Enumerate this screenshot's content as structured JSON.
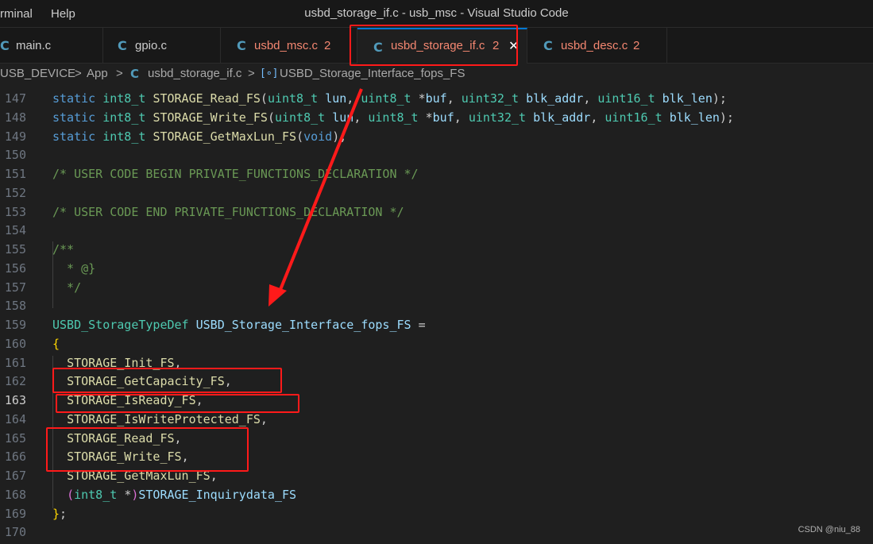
{
  "window": {
    "title": "usbd_storage_if.c - usb_msc - Visual Studio Code",
    "menu": [
      "rminal",
      "Help"
    ]
  },
  "tabs": [
    {
      "label": "main.c",
      "badge": "",
      "error": false,
      "active": false
    },
    {
      "label": "gpio.c",
      "badge": "",
      "error": false,
      "active": false
    },
    {
      "label": "usbd_msc.c",
      "badge": "2",
      "error": true,
      "active": false
    },
    {
      "label": "usbd_storage_if.c",
      "badge": "2",
      "error": true,
      "active": true
    },
    {
      "label": "usbd_desc.c",
      "badge": "2",
      "error": true,
      "active": false
    }
  ],
  "tab_icon": "C",
  "close_glyph": "✕",
  "breadcrumb": {
    "segments": [
      "USB_DEVICE",
      "App",
      "usbd_storage_if.c",
      "USBD_Storage_Interface_fops_FS"
    ],
    "separator": ">",
    "symbol_glyph": "[∘]"
  },
  "editor": {
    "current_line": "163",
    "lines": [
      {
        "num": "147",
        "tokens": [
          [
            "kw",
            "static "
          ],
          [
            "ty",
            "int8_t "
          ],
          [
            "fn",
            "STORAGE_Read_FS"
          ],
          [
            "pn",
            "("
          ],
          [
            "ty",
            "uint8_t "
          ],
          [
            "id",
            "lun"
          ],
          [
            "pn",
            ", "
          ],
          [
            "ty",
            "uint8_t "
          ],
          [
            "pn",
            "*"
          ],
          [
            "id",
            "buf"
          ],
          [
            "pn",
            ", "
          ],
          [
            "ty",
            "uint32_t "
          ],
          [
            "id",
            "blk_addr"
          ],
          [
            "pn",
            ", "
          ],
          [
            "ty",
            "uint16_t "
          ],
          [
            "id",
            "blk_len"
          ],
          [
            "pn",
            ");"
          ]
        ]
      },
      {
        "num": "148",
        "tokens": [
          [
            "kw",
            "static "
          ],
          [
            "ty",
            "int8_t "
          ],
          [
            "fn",
            "STORAGE_Write_FS"
          ],
          [
            "pn",
            "("
          ],
          [
            "ty",
            "uint8_t "
          ],
          [
            "id",
            "lun"
          ],
          [
            "pn",
            ", "
          ],
          [
            "ty",
            "uint8_t "
          ],
          [
            "pn",
            "*"
          ],
          [
            "id",
            "buf"
          ],
          [
            "pn",
            ", "
          ],
          [
            "ty",
            "uint32_t "
          ],
          [
            "id",
            "blk_addr"
          ],
          [
            "pn",
            ", "
          ],
          [
            "ty",
            "uint16_t "
          ],
          [
            "id",
            "blk_len"
          ],
          [
            "pn",
            ");"
          ]
        ]
      },
      {
        "num": "149",
        "tokens": [
          [
            "kw",
            "static "
          ],
          [
            "ty",
            "int8_t "
          ],
          [
            "fn",
            "STORAGE_GetMaxLun_FS"
          ],
          [
            "pn",
            "("
          ],
          [
            "kw",
            "void"
          ],
          [
            "pn",
            ");"
          ]
        ]
      },
      {
        "num": "150",
        "tokens": []
      },
      {
        "num": "151",
        "tokens": [
          [
            "cm",
            "/* USER CODE BEGIN PRIVATE_FUNCTIONS_DECLARATION */"
          ]
        ]
      },
      {
        "num": "152",
        "tokens": []
      },
      {
        "num": "153",
        "tokens": [
          [
            "cm",
            "/* USER CODE END PRIVATE_FUNCTIONS_DECLARATION */"
          ]
        ]
      },
      {
        "num": "154",
        "tokens": []
      },
      {
        "num": "155",
        "tokens": [
          [
            "cm",
            "/**"
          ]
        ]
      },
      {
        "num": "156",
        "tokens": [
          [
            "cm",
            "  * @}"
          ]
        ]
      },
      {
        "num": "157",
        "tokens": [
          [
            "cm",
            "  */"
          ]
        ]
      },
      {
        "num": "158",
        "tokens": []
      },
      {
        "num": "159",
        "tokens": [
          [
            "ty",
            "USBD_StorageTypeDef "
          ],
          [
            "id",
            "USBD_Storage_Interface_fops_FS"
          ],
          [
            "pn",
            " ="
          ]
        ]
      },
      {
        "num": "160",
        "tokens": [
          [
            "br",
            "{"
          ]
        ]
      },
      {
        "num": "161",
        "tokens": [
          [
            "pn",
            "  "
          ],
          [
            "fn",
            "STORAGE_Init_FS"
          ],
          [
            "pn",
            ","
          ]
        ]
      },
      {
        "num": "162",
        "tokens": [
          [
            "pn",
            "  "
          ],
          [
            "fn",
            "STORAGE_GetCapacity_FS"
          ],
          [
            "pn",
            ","
          ]
        ]
      },
      {
        "num": "163",
        "tokens": [
          [
            "pn",
            "  "
          ],
          [
            "fn",
            "STORAGE_IsReady_FS"
          ],
          [
            "pn",
            ","
          ]
        ]
      },
      {
        "num": "164",
        "tokens": [
          [
            "pn",
            "  "
          ],
          [
            "fn",
            "STORAGE_IsWriteProtected_FS"
          ],
          [
            "pn",
            ","
          ]
        ]
      },
      {
        "num": "165",
        "tokens": [
          [
            "pn",
            "  "
          ],
          [
            "fn",
            "STORAGE_Read_FS"
          ],
          [
            "pn",
            ","
          ]
        ]
      },
      {
        "num": "166",
        "tokens": [
          [
            "pn",
            "  "
          ],
          [
            "fn",
            "STORAGE_Write_FS"
          ],
          [
            "pn",
            ","
          ]
        ]
      },
      {
        "num": "167",
        "tokens": [
          [
            "pn",
            "  "
          ],
          [
            "fn",
            "STORAGE_GetMaxLun_FS"
          ],
          [
            "pn",
            ","
          ]
        ]
      },
      {
        "num": "168",
        "tokens": [
          [
            "pn",
            "  "
          ],
          [
            "paren",
            "("
          ],
          [
            "ty",
            "int8_t "
          ],
          [
            "pn",
            "*"
          ],
          [
            "paren",
            ")"
          ],
          [
            "id",
            "STORAGE_Inquirydata_FS"
          ]
        ]
      },
      {
        "num": "169",
        "tokens": [
          [
            "br",
            "}"
          ],
          [
            "pn",
            ";"
          ]
        ]
      },
      {
        "num": "170",
        "tokens": []
      }
    ]
  },
  "colors": {
    "annotation": "#ff1a1a",
    "accent": "#0078d4"
  },
  "watermark": "CSDN @niu_88"
}
